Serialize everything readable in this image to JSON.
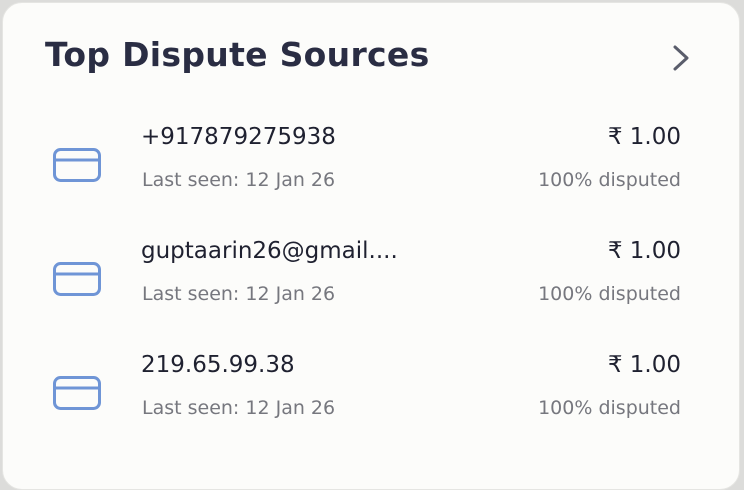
{
  "widget": {
    "title": "Top Dispute Sources",
    "accent_color": "#6f95d6",
    "title_color": "#2a2d43"
  },
  "sources": [
    {
      "icon": "credit-card-icon",
      "source": "+917879275938",
      "last_seen": "Last seen: 12 Jan 26",
      "amount": "₹ 1.00",
      "disputed": "100% disputed"
    },
    {
      "icon": "credit-card-icon",
      "source": "guptaarin26@gmail....",
      "last_seen": "Last seen: 12 Jan 26",
      "amount": "₹ 1.00",
      "disputed": "100% disputed"
    },
    {
      "icon": "credit-card-icon",
      "source": "219.65.99.38",
      "last_seen": "Last seen: 12 Jan 26",
      "amount": "₹ 1.00",
      "disputed": "100% disputed"
    }
  ]
}
